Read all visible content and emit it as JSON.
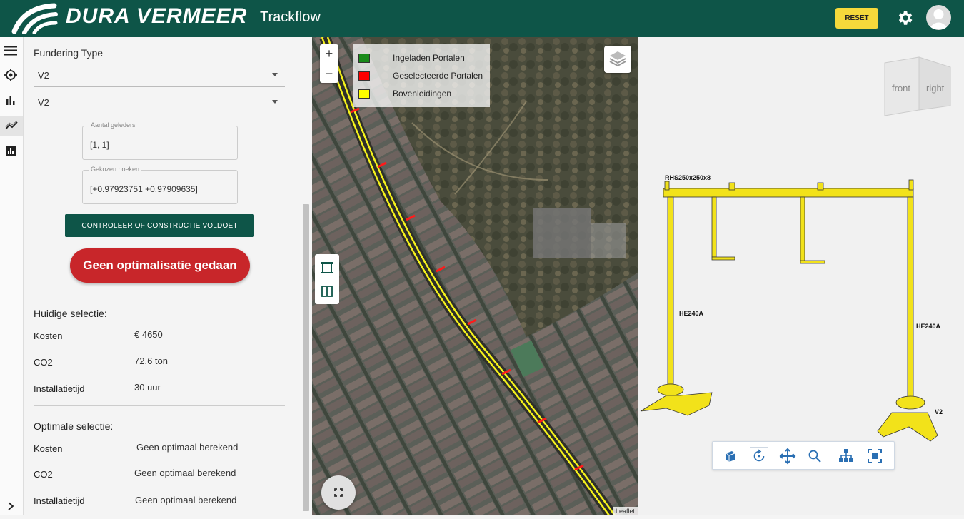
{
  "header": {
    "brand": "DURA VERMEER",
    "app_name": "Trackflow",
    "reset_label": "RESET"
  },
  "panel": {
    "fundering_label": "Fundering Type",
    "select_1": "V2",
    "select_2": "V2",
    "aantal_legend": "Aantal geleders",
    "aantal_value": "[1, 1]",
    "hoeken_legend": "Gekozen hoeken",
    "hoeken_value": "[+0.97923751 +0.97909635]",
    "check_button": "CONTROLEER OF CONSTRUCTIE VOLDOET",
    "opt_button": "Geen optimalisatie gedaan",
    "current_title": "Huidige selectie:",
    "current": [
      {
        "key": "Kosten",
        "value": "€ 4650"
      },
      {
        "key": "CO2",
        "value": "72.6 ton"
      },
      {
        "key": "Installatietijd",
        "value": "30 uur"
      }
    ],
    "optimal_title": "Optimale selectie:",
    "optimal": [
      {
        "key": "Kosten",
        "value": "Geen optimaal berekend"
      },
      {
        "key": "CO2",
        "value": "Geen optimaal berekend"
      },
      {
        "key": "Installatietijd",
        "value": "Geen optimaal berekend"
      }
    ]
  },
  "map": {
    "zoom_in": "+",
    "zoom_out": "−",
    "legend": [
      {
        "label": "Ingeladen Portalen",
        "color": "#1a8a1a"
      },
      {
        "label": "Geselecteerde Portalen",
        "color": "#ff0000"
      },
      {
        "label": "Bovenleidingen",
        "color": "#ffff00"
      }
    ],
    "attribution": "Leaflet"
  },
  "viewer": {
    "cube_front": "front",
    "cube_right": "right",
    "beam_label": "RHS250x250x8",
    "left_col_label": "HE240A",
    "right_col_label": "HE240A",
    "foundation_label": "V2"
  },
  "colors": {
    "header_green": "#0e5548",
    "reset_yellow": "#f5d93b",
    "opt_red": "#c8262a",
    "structure_yellow": "#f2e21a"
  }
}
